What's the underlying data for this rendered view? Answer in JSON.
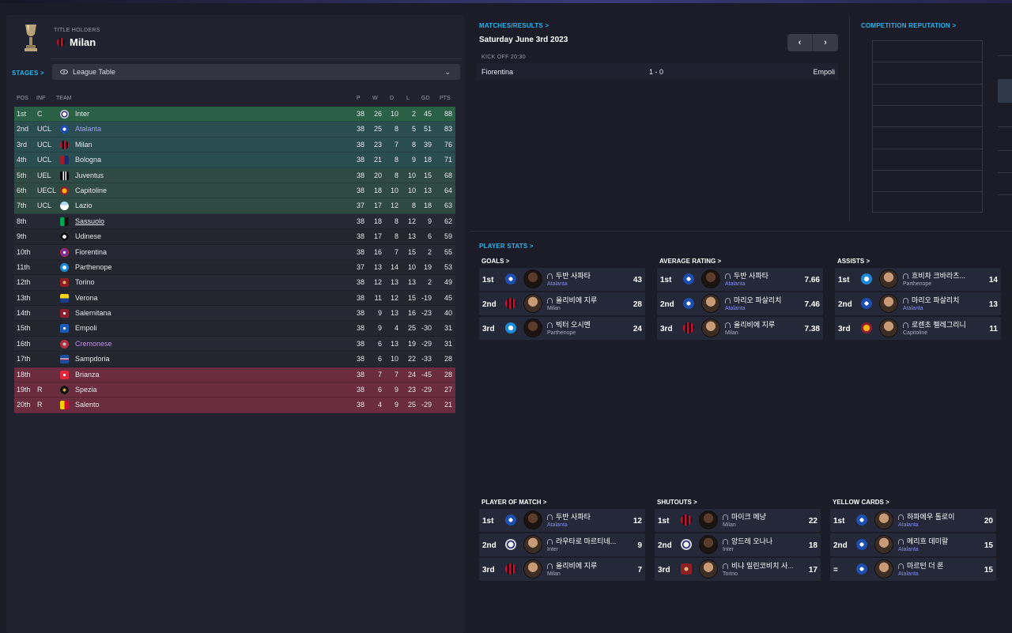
{
  "header": {
    "title_holders_label": "TITLE HOLDERS",
    "title_holder_team": "Milan"
  },
  "stages": {
    "label": "STAGES >",
    "selected": "League Table"
  },
  "league_table": {
    "columns": {
      "pos": "POS",
      "inf": "INF",
      "team": "TEAM",
      "p": "P",
      "w": "W",
      "d": "D",
      "l": "L",
      "gd": "GD",
      "pts": "PTS"
    },
    "rows": [
      {
        "pos": "1st",
        "inf": "C",
        "team": "Inter",
        "crest": "inter-crest",
        "p": "38",
        "w": "26",
        "d": "10",
        "l": "2",
        "gd": "45",
        "pts": "88"
      },
      {
        "pos": "2nd",
        "inf": "UCL",
        "team": "Atalanta",
        "crest": "atalanta-crest",
        "p": "38",
        "w": "25",
        "d": "8",
        "l": "5",
        "gd": "51",
        "pts": "83"
      },
      {
        "pos": "3rd",
        "inf": "UCL",
        "team": "Milan",
        "crest": "milan-crest",
        "p": "38",
        "w": "23",
        "d": "7",
        "l": "8",
        "gd": "39",
        "pts": "76"
      },
      {
        "pos": "4th",
        "inf": "UCL",
        "team": "Bologna",
        "crest": "bologna-crest",
        "p": "38",
        "w": "21",
        "d": "8",
        "l": "9",
        "gd": "18",
        "pts": "71"
      },
      {
        "pos": "5th",
        "inf": "UEL",
        "team": "Juventus",
        "crest": "juventus-crest",
        "p": "38",
        "w": "20",
        "d": "8",
        "l": "10",
        "gd": "15",
        "pts": "68"
      },
      {
        "pos": "6th",
        "inf": "UECL",
        "team": "Capitoline",
        "crest": "capitoline-crest",
        "p": "38",
        "w": "18",
        "d": "10",
        "l": "10",
        "gd": "13",
        "pts": "64"
      },
      {
        "pos": "7th",
        "inf": "UCL",
        "team": "Lazio",
        "crest": "lazio-crest",
        "p": "37",
        "w": "17",
        "d": "12",
        "l": "8",
        "gd": "18",
        "pts": "63"
      },
      {
        "pos": "8th",
        "inf": "",
        "team": "Sassuolo",
        "crest": "sassuolo-crest",
        "p": "38",
        "w": "18",
        "d": "8",
        "l": "12",
        "gd": "9",
        "pts": "62"
      },
      {
        "pos": "9th",
        "inf": "",
        "team": "Udinese",
        "crest": "udinese-crest",
        "p": "38",
        "w": "17",
        "d": "8",
        "l": "13",
        "gd": "6",
        "pts": "59"
      },
      {
        "pos": "10th",
        "inf": "",
        "team": "Fiorentina",
        "crest": "fiorentina-crest",
        "p": "38",
        "w": "16",
        "d": "7",
        "l": "15",
        "gd": "2",
        "pts": "55"
      },
      {
        "pos": "11th",
        "inf": "",
        "team": "Parthenope",
        "crest": "parthenope-crest",
        "p": "37",
        "w": "13",
        "d": "14",
        "l": "10",
        "gd": "19",
        "pts": "53"
      },
      {
        "pos": "12th",
        "inf": "",
        "team": "Torino",
        "crest": "torino-crest",
        "p": "38",
        "w": "12",
        "d": "13",
        "l": "13",
        "gd": "2",
        "pts": "49"
      },
      {
        "pos": "13th",
        "inf": "",
        "team": "Verona",
        "crest": "verona-crest",
        "p": "38",
        "w": "11",
        "d": "12",
        "l": "15",
        "gd": "-19",
        "pts": "45"
      },
      {
        "pos": "14th",
        "inf": "",
        "team": "Salernitana",
        "crest": "salernitana-crest",
        "p": "38",
        "w": "9",
        "d": "13",
        "l": "16",
        "gd": "-23",
        "pts": "40"
      },
      {
        "pos": "15th",
        "inf": "",
        "team": "Empoli",
        "crest": "empoli-crest",
        "p": "38",
        "w": "9",
        "d": "4",
        "l": "25",
        "gd": "-30",
        "pts": "31"
      },
      {
        "pos": "16th",
        "inf": "",
        "team": "Cremonese",
        "crest": "cremonese-crest",
        "p": "38",
        "w": "6",
        "d": "13",
        "l": "19",
        "gd": "-29",
        "pts": "31"
      },
      {
        "pos": "17th",
        "inf": "",
        "team": "Sampdoria",
        "crest": "sampdoria-crest",
        "p": "38",
        "w": "6",
        "d": "10",
        "l": "22",
        "gd": "-33",
        "pts": "28"
      },
      {
        "pos": "18th",
        "inf": "",
        "team": "Brianza",
        "crest": "brianza-crest",
        "p": "38",
        "w": "7",
        "d": "7",
        "l": "24",
        "gd": "-45",
        "pts": "28"
      },
      {
        "pos": "19th",
        "inf": "R",
        "team": "Spezia",
        "crest": "spezia-crest",
        "p": "38",
        "w": "6",
        "d": "9",
        "l": "23",
        "gd": "-29",
        "pts": "27"
      },
      {
        "pos": "20th",
        "inf": "R",
        "team": "Salento",
        "crest": "salento-crest",
        "p": "38",
        "w": "4",
        "d": "9",
        "l": "25",
        "gd": "-29",
        "pts": "21"
      }
    ]
  },
  "matches": {
    "title": "MATCHES/RESULTS >",
    "date": "Saturday June 3rd 2023",
    "prev": "‹",
    "next": "›",
    "kickoff": "KICK OFF 20:30",
    "home": "Fiorentina",
    "score": "1 - 0",
    "away": "Empoli"
  },
  "reputation": {
    "title": "COMPETITION REPUTATION >"
  },
  "player_stats": {
    "title": "PLAYER STATS >",
    "goals": {
      "title": "GOALS >",
      "rows": [
        {
          "rank": "1st",
          "club_icon": "atalanta-crest",
          "name": "두반 사파타",
          "club": "Atalanta",
          "value": "43"
        },
        {
          "rank": "2nd",
          "club_icon": "milan-crest",
          "name": "올리비에 지루",
          "club": "Milan",
          "value": "28"
        },
        {
          "rank": "3rd",
          "club_icon": "napoli-crest",
          "name": "빅터 오시멘",
          "club": "Parthenope",
          "value": "24"
        }
      ]
    },
    "average_rating": {
      "title": "AVERAGE RATING >",
      "rows": [
        {
          "rank": "1st",
          "club_icon": "atalanta-crest",
          "name": "두반 사파타",
          "club": "Atalanta",
          "value": "7.66"
        },
        {
          "rank": "2nd",
          "club_icon": "atalanta-crest",
          "name": "마리오 파살리치",
          "club": "Atalanta",
          "value": "7.46"
        },
        {
          "rank": "3rd",
          "club_icon": "milan-crest",
          "name": "올리비에 지루",
          "club": "Milan",
          "value": "7.38"
        }
      ]
    },
    "assists": {
      "title": "ASSISTS >",
      "rows": [
        {
          "rank": "1st",
          "club_icon": "napoli-crest",
          "name": "흐비차 크바라츠...",
          "club": "Parthenope",
          "value": "14"
        },
        {
          "rank": "2nd",
          "club_icon": "atalanta-crest",
          "name": "마리오 파살리치",
          "club": "Atalanta",
          "value": "13"
        },
        {
          "rank": "3rd",
          "club_icon": "capitoline-crest",
          "name": "로렌초 펠레그리니",
          "club": "Capitoline",
          "value": "11"
        }
      ]
    },
    "player_of_match": {
      "title": "PLAYER OF MATCH >",
      "rows": [
        {
          "rank": "1st",
          "club_icon": "atalanta-crest",
          "name": "두반 사파타",
          "club": "Atalanta",
          "value": "12"
        },
        {
          "rank": "2nd",
          "club_icon": "inter-crest",
          "name": "라우타로 마르티네...",
          "club": "Inter",
          "value": "9"
        },
        {
          "rank": "3rd",
          "club_icon": "milan-crest",
          "name": "올리비에 지루",
          "club": "Milan",
          "value": "7"
        }
      ]
    },
    "shutouts": {
      "title": "SHUTOUTS >",
      "rows": [
        {
          "rank": "1st",
          "club_icon": "milan-crest",
          "name": "마이크 메냥",
          "club": "Milan",
          "value": "22"
        },
        {
          "rank": "2nd",
          "club_icon": "inter-crest",
          "name": "앙드레 오나나",
          "club": "Inter",
          "value": "18"
        },
        {
          "rank": "3rd",
          "club_icon": "torino-crest",
          "name": "비냐 밀린코비치 사...",
          "club": "Torino",
          "value": "17"
        }
      ]
    },
    "yellow_cards": {
      "title": "YELLOW CARDS >",
      "rows": [
        {
          "rank": "1st",
          "club_icon": "atalanta-crest",
          "name": "하파에우 톨로이",
          "club": "Atalanta",
          "value": "20"
        },
        {
          "rank": "2nd",
          "club_icon": "atalanta-crest",
          "name": "메리흐 데미랄",
          "club": "Atalanta",
          "value": "15"
        },
        {
          "rank": "=",
          "club_icon": "atalanta-crest",
          "name": "마르턴 더 론",
          "club": "Atalanta",
          "value": "15"
        }
      ]
    }
  }
}
